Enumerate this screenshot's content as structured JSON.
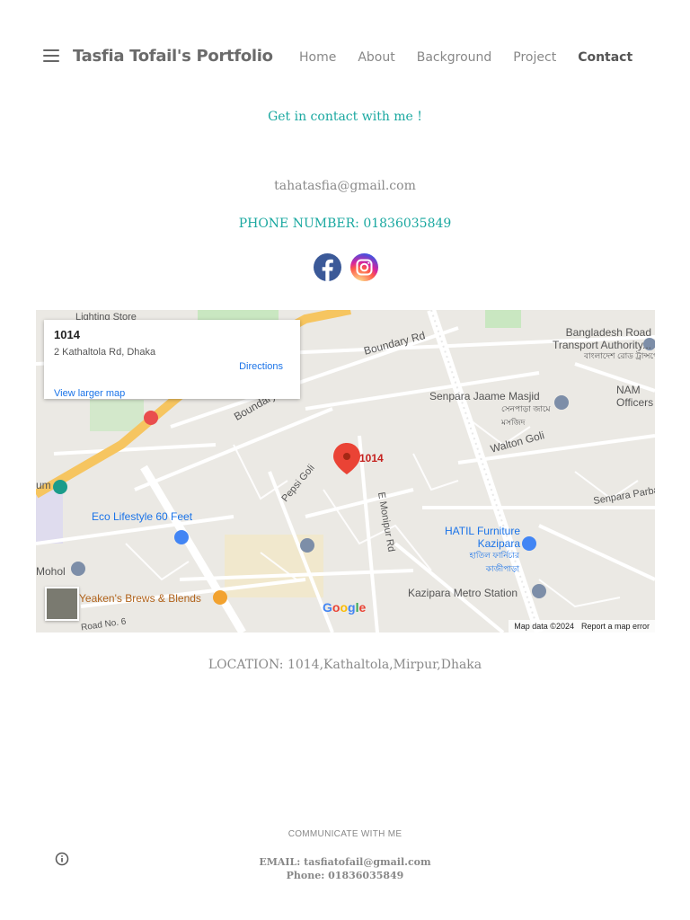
{
  "header": {
    "site_title": "Tasfia Tofail's Portfolio",
    "nav": [
      "Home",
      "About",
      "Background",
      "Project",
      "Contact"
    ],
    "active_nav": "Contact"
  },
  "main": {
    "heading": "Get in contact with me !",
    "email": "tahatasfia@gmail.com",
    "phone": "PHONE NUMBER: 01836035849",
    "social_icons": [
      "facebook-icon",
      "instagram-icon"
    ],
    "location": "LOCATION: 1014,Kathaltola,Mirpur,Dhaka"
  },
  "map": {
    "place_name": "1014",
    "address": "2 Kathaltola Rd, Dhaka",
    "directions_label": "Directions",
    "larger_map_label": "View larger map",
    "pin_label": "1014",
    "labels": {
      "lighting_store": "Lighting Store",
      "boundary_rd": "Boundary Rd",
      "brta": "Bangladesh Road Transport Authority...",
      "brta_bn": "বাংলাদেশ রোড ট্রান্সপোর্ট...",
      "nam_offices": "NAM Officers",
      "senpara_masjid": "Senpara Jaame Masjid",
      "senpara_masjid_bn": "সেনপাড়া জামে মসজিদ",
      "walton_goli": "Walton Goli",
      "boundary2": "Boundary",
      "pepsi_goli": "Pepsi Goli",
      "e_monipur_rd": "E Monipur Rd",
      "eco_lifestyle": "Eco Lifestyle 60 Feet",
      "hatil": "HATIL Furniture Kazipara",
      "hatil_bn": "হাতিল ফার্নিচার কাজীপাড়া",
      "senpara_parbata": "Senpara Parbata",
      "mohol": "Mohol",
      "yeakens": "Yeaken's Brews & Blends",
      "kazipara_metro": "Kazipara Metro Station",
      "road_no6": "Road No. 6",
      "um": "um"
    },
    "google_logo": "Google",
    "map_data": "Map data ©2024",
    "report_error": "Report a map error",
    "colors": {
      "road_main": "#f6c560",
      "road_minor": "#ffffff",
      "land": "#ebe9e4",
      "park": "#c9e7c1",
      "pin": "#ea4335"
    }
  },
  "footer": {
    "title": "COMMUNICATE WITH ME",
    "email": "EMAIL: tasfiatofail@gmail.com",
    "phone": "Phone: 01836035849"
  },
  "colors": {
    "accent": "#1aa8a0",
    "muted_text": "#8a8a8a"
  }
}
